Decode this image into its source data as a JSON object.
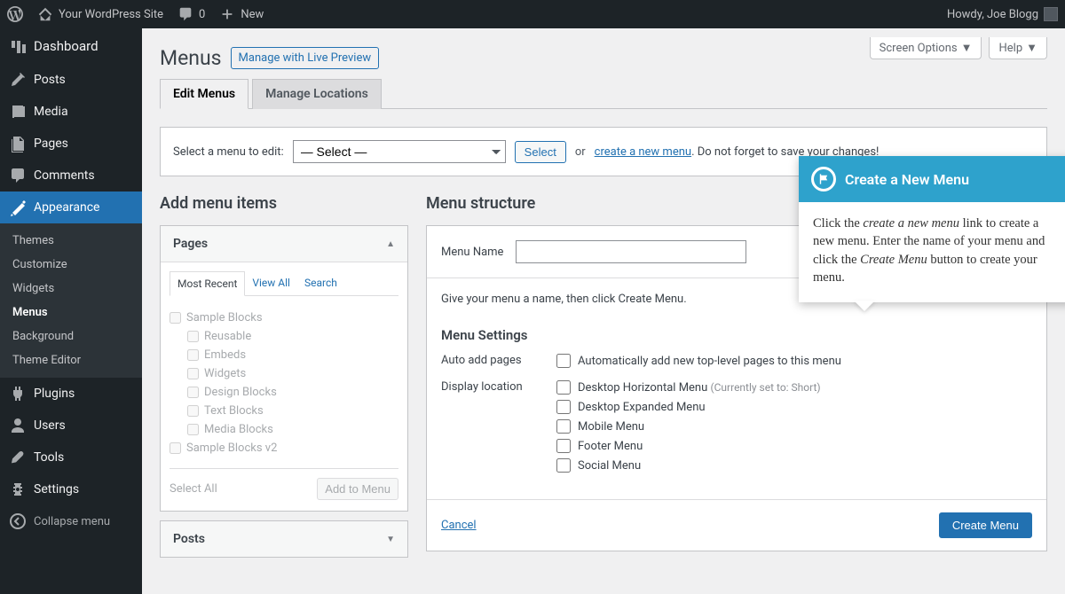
{
  "adminbar": {
    "site_name": "Your WordPress Site",
    "comments_count": "0",
    "new_label": "New",
    "howdy": "Howdy, Joe Blogg"
  },
  "sidebar": {
    "dashboard": "Dashboard",
    "posts": "Posts",
    "media": "Media",
    "pages": "Pages",
    "comments": "Comments",
    "appearance": "Appearance",
    "appearance_sub": {
      "themes": "Themes",
      "customize": "Customize",
      "widgets": "Widgets",
      "menus": "Menus",
      "background": "Background",
      "theme_editor": "Theme Editor"
    },
    "plugins": "Plugins",
    "users": "Users",
    "tools": "Tools",
    "settings": "Settings",
    "collapse": "Collapse menu"
  },
  "top_buttons": {
    "screen_options": "Screen Options",
    "help": "Help"
  },
  "page": {
    "title": "Menus",
    "manage_live": "Manage with Live Preview",
    "tab_edit": "Edit Menus",
    "tab_locations": "Manage Locations"
  },
  "selectbar": {
    "label": "Select a menu to edit:",
    "placeholder": "— Select —",
    "select_btn": "Select",
    "or": "or",
    "create_link": "create a new menu",
    "create_suffix": ". Do not forget to save your changes!"
  },
  "left": {
    "heading": "Add menu items",
    "acc_pages": "Pages",
    "acc_posts": "Posts",
    "inner_tabs": {
      "recent": "Most Recent",
      "viewall": "View All",
      "search": "Search"
    },
    "pages": [
      {
        "label": "Sample Blocks",
        "depth": 0
      },
      {
        "label": "Reusable",
        "depth": 1
      },
      {
        "label": "Embeds",
        "depth": 1
      },
      {
        "label": "Widgets",
        "depth": 1
      },
      {
        "label": "Design Blocks",
        "depth": 1
      },
      {
        "label": "Text Blocks",
        "depth": 1
      },
      {
        "label": "Media Blocks",
        "depth": 1
      },
      {
        "label": "Sample Blocks v2",
        "depth": 0
      }
    ],
    "select_all": "Select All",
    "add_to_menu": "Add to Menu"
  },
  "right": {
    "heading": "Menu structure",
    "menu_name_label": "Menu Name",
    "instruction": "Give your menu a name, then click Create Menu.",
    "settings_h": "Menu Settings",
    "auto_add_label": "Auto add pages",
    "auto_add_text": "Automatically add new top-level pages to this menu",
    "display_loc_label": "Display location",
    "locations": [
      {
        "label": "Desktop Horizontal Menu",
        "hint": "(Currently set to: Short)"
      },
      {
        "label": "Desktop Expanded Menu",
        "hint": ""
      },
      {
        "label": "Mobile Menu",
        "hint": ""
      },
      {
        "label": "Footer Menu",
        "hint": ""
      },
      {
        "label": "Social Menu",
        "hint": ""
      }
    ],
    "cancel": "Cancel",
    "create_menu": "Create Menu"
  },
  "tour": {
    "title": "Create a New Menu",
    "body_html": "Click the <em>create a new menu</em> link to create a new menu. Enter the name of your menu and click the <em>Create Menu</em> button to create your menu."
  }
}
